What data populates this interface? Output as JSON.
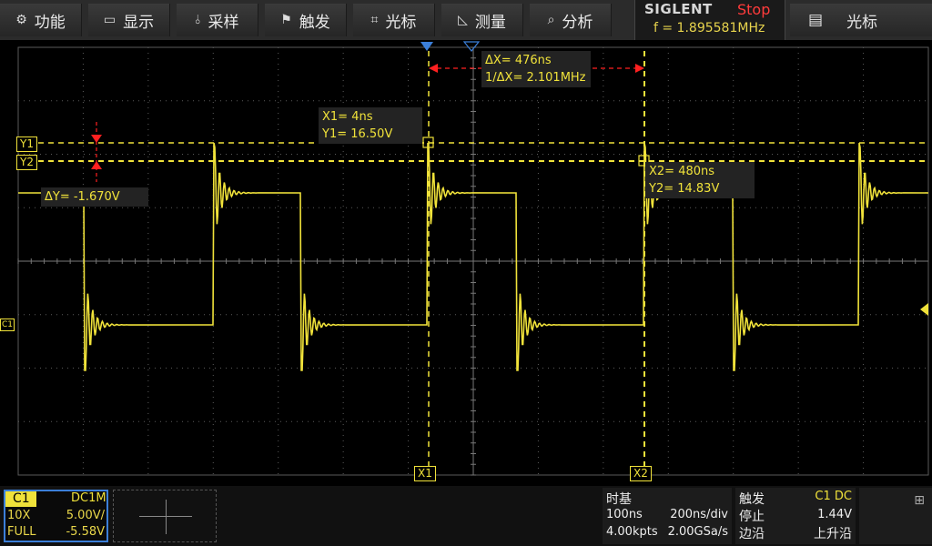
{
  "menu": {
    "items": [
      {
        "label": "功能",
        "icon": "gear-icon",
        "glyph": "⚙"
      },
      {
        "label": "显示",
        "icon": "monitor-icon",
        "glyph": "🖵"
      },
      {
        "label": "采样",
        "icon": "sampling-icon",
        "glyph": "⫰"
      },
      {
        "label": "触发",
        "icon": "trigger-flag-icon",
        "glyph": "⚑"
      },
      {
        "label": "光标",
        "icon": "cursor-cross-icon",
        "glyph": "⌗"
      },
      {
        "label": "测量",
        "icon": "measure-icon",
        "glyph": "◺"
      },
      {
        "label": "分析",
        "icon": "analysis-icon",
        "glyph": "⌕"
      }
    ],
    "right_label": "光标",
    "right_icon_glyph": "▤"
  },
  "brand": {
    "name": "SIGLENT",
    "run_state": "Stop",
    "frequency": "f = 1.895581MHz"
  },
  "cursors": {
    "delta_x": "ΔX= 476ns",
    "inv_delta_x": "1/ΔX= 2.101MHz",
    "x1_time": "X1= 4ns",
    "y1_value": "Y1= 16.50V",
    "x2_time": "X2= 480ns",
    "y2_value": "Y2= 14.83V",
    "delta_y": "ΔY= -1.670V",
    "y1_label": "Y1",
    "y2_label": "Y2",
    "x1_label": "X1",
    "x2_label": "X2",
    "channel_marker": "C1"
  },
  "channel": {
    "name": "C1",
    "coupling": "DC1M",
    "probe": "10X",
    "scale": "5.00V/",
    "bandwidth": "FULL",
    "offset": "-5.58V"
  },
  "timebase": {
    "title": "时基",
    "delay": "100ns",
    "scale": "200ns/div",
    "memory": "4.00kpts",
    "sample_rate": "2.00GSa/s"
  },
  "trigger": {
    "title": "触发",
    "source": "C1 DC",
    "mode": "停止",
    "level": "1.44V",
    "type": "边沿",
    "slope": "上升沿"
  },
  "colors": {
    "trace": "#f0e23a",
    "grid": "#5a5a5a",
    "delta_arrow": "#ff2020",
    "stop": "#ff3b3b",
    "channel_border": "#3b7fd9"
  }
}
